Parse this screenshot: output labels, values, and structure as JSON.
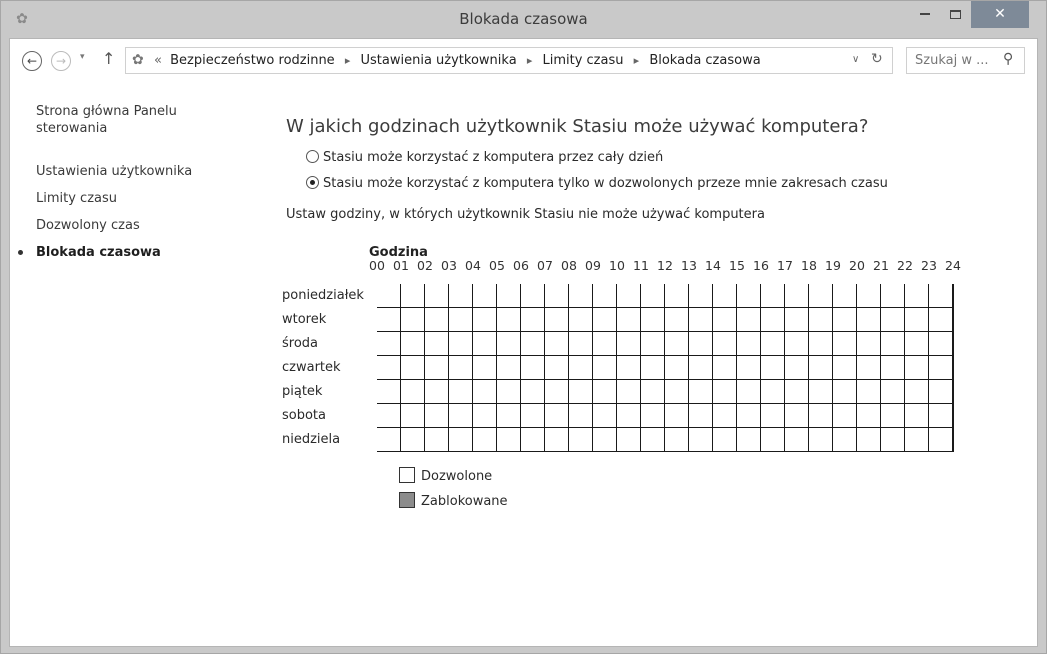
{
  "window": {
    "title": "Blokada czasowa",
    "close_glyph": "✕"
  },
  "nav": {
    "back_glyph": "←",
    "forward_glyph": "→",
    "dropdown_glyph": "▾",
    "up_glyph": "↑"
  },
  "address": {
    "prefix": "«",
    "separator": "▸",
    "crumbs": [
      "Bezpieczeństwo rodzinne",
      "Ustawienia użytkownika",
      "Limity czasu",
      "Blokada czasowa"
    ],
    "dropdown_glyph": "∨",
    "refresh_glyph": "↻"
  },
  "search": {
    "placeholder": "Szukaj w ...",
    "icon_glyph": "⚲"
  },
  "sidebar": {
    "items": [
      {
        "label": "Strona główna Panelu sterowania"
      },
      {
        "label": "Ustawienia użytkownika"
      },
      {
        "label": "Limity czasu"
      },
      {
        "label": "Dozwolony czas"
      },
      {
        "label": "Blokada czasowa",
        "active": true
      }
    ]
  },
  "main": {
    "heading": "W jakich godzinach użytkownik Stasiu może używać komputera?",
    "options": [
      {
        "label": "Stasiu może korzystać z komputera przez cały dzień",
        "checked": false
      },
      {
        "label": "Stasiu może korzystać z komputera tylko w dozwolonych przeze mnie zakresach czasu",
        "checked": true
      }
    ],
    "instruction": "Ustaw godziny, w których użytkownik Stasiu nie może używać komputera"
  },
  "schedule": {
    "hour_header": "Godzina",
    "hours": [
      "00",
      "01",
      "02",
      "03",
      "04",
      "05",
      "06",
      "07",
      "08",
      "09",
      "10",
      "11",
      "12",
      "13",
      "14",
      "15",
      "16",
      "17",
      "18",
      "19",
      "20",
      "21",
      "22",
      "23",
      "24"
    ],
    "days": [
      "poniedziałek",
      "wtorek",
      "środa",
      "czwartek",
      "piątek",
      "sobota",
      "niedziela"
    ],
    "blocked_hours": {
      "poniedziałek": [],
      "wtorek": [],
      "środa": [],
      "czwartek": [],
      "piątek": [],
      "sobota": [],
      "niedziela": []
    }
  },
  "legend": {
    "allowed_label": "Dozwolone",
    "blocked_label": "Zablokowane",
    "allowed_color": "#ffffff",
    "blocked_color": "#8c8c8c"
  }
}
